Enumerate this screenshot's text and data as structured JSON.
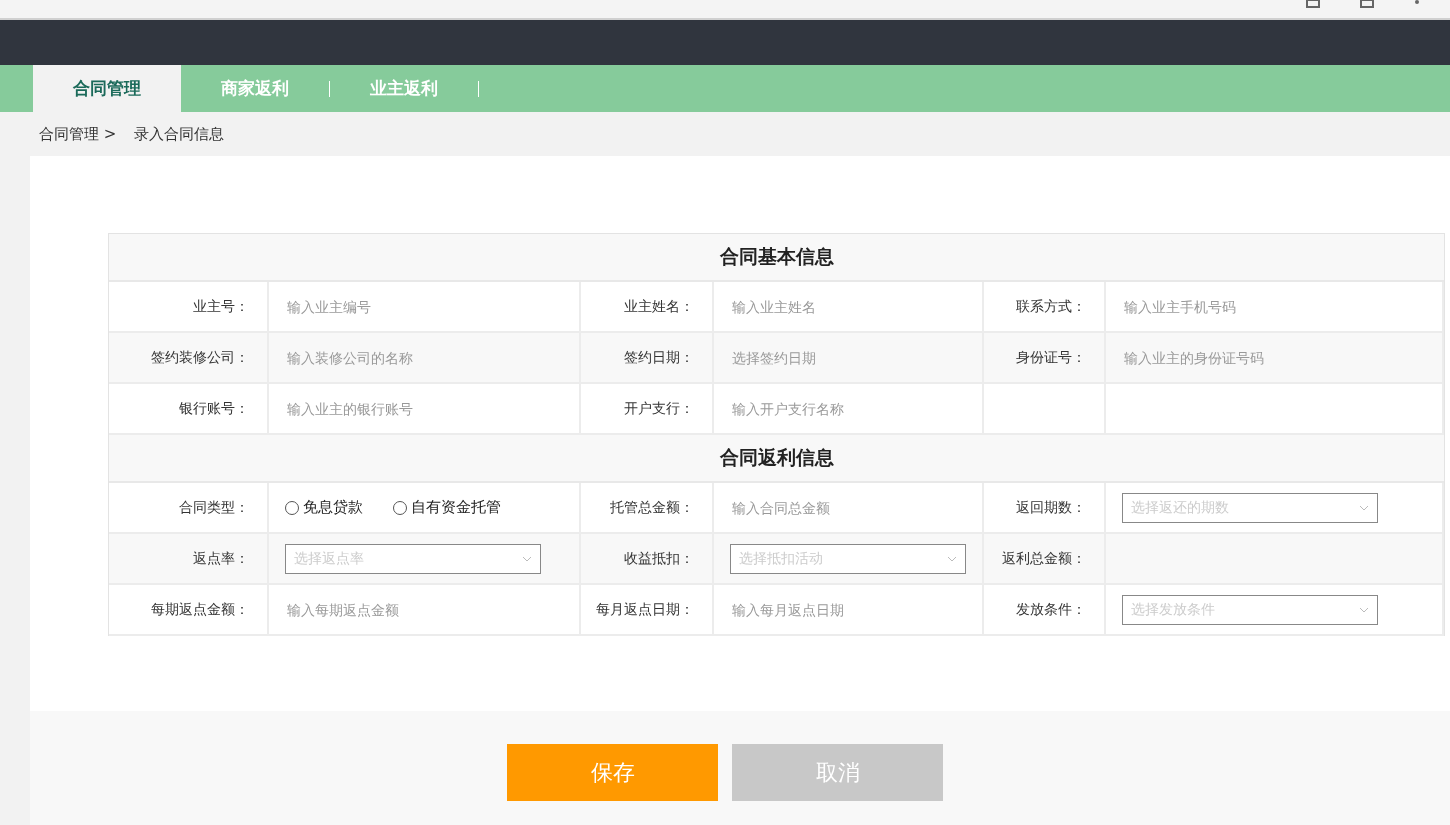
{
  "nav": {
    "tabs": [
      {
        "label": "合同管理",
        "selected": true
      },
      {
        "label": "商家返利",
        "selected": false
      },
      {
        "label": "业主返利",
        "selected": false
      }
    ]
  },
  "breadcrumb": [
    "合同管理 >",
    "录入合同信息"
  ],
  "sections": [
    {
      "title": "合同基本信息",
      "rows": [
        [
          {
            "label": "业主号：",
            "kind": "input",
            "placeholder": "输入业主编号"
          },
          {
            "label": "业主姓名：",
            "kind": "input",
            "placeholder": "输入业主姓名"
          },
          {
            "label": "联系方式：",
            "kind": "input",
            "placeholder": "输入业主手机号码"
          }
        ],
        [
          {
            "label": "签约装修公司：",
            "kind": "input",
            "placeholder": "输入装修公司的名称"
          },
          {
            "label": "签约日期：",
            "kind": "input",
            "placeholder": "选择签约日期"
          },
          {
            "label": "身份证号：",
            "kind": "input",
            "placeholder": "输入业主的身份证号码"
          }
        ],
        [
          {
            "label": "银行账号：",
            "kind": "input",
            "placeholder": "输入业主的银行账号"
          },
          {
            "label": "开户支行：",
            "kind": "input",
            "placeholder": "输入开户支行名称"
          },
          {
            "kind": "empty"
          }
        ]
      ]
    },
    {
      "title": "合同返利信息",
      "rows": [
        [
          {
            "label": "合同类型：",
            "kind": "radio",
            "options": [
              {
                "label": "免息贷款",
                "selected": false
              },
              {
                "label": "自有资金托管",
                "selected": false
              }
            ]
          },
          {
            "label": "托管总金额：",
            "kind": "input",
            "placeholder": "输入合同总金额"
          },
          {
            "label": "返回期数：",
            "kind": "select",
            "placeholder": "选择返还的期数"
          }
        ],
        [
          {
            "label": "返点率：",
            "kind": "select",
            "placeholder": "选择返点率"
          },
          {
            "label": "收益抵扣：",
            "kind": "select",
            "placeholder": "选择抵扣活动"
          },
          {
            "label": "返利总金额：",
            "kind": "value"
          }
        ],
        [
          {
            "label": "每期返点金额：",
            "kind": "input",
            "placeholder": "输入每期返点金额"
          },
          {
            "label": "每月返点日期：",
            "kind": "input",
            "placeholder": "输入每月返点日期"
          },
          {
            "label": "发放条件：",
            "kind": "select",
            "placeholder": "选择发放条件"
          }
        ]
      ]
    }
  ],
  "buttons": [
    {
      "label": "保存",
      "kind": "primary"
    },
    {
      "label": "取消",
      "kind": "secondary"
    }
  ]
}
